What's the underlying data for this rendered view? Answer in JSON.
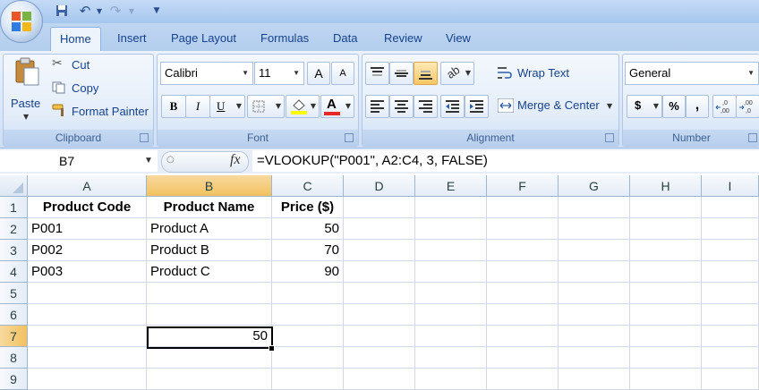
{
  "tabs": [
    "Home",
    "Insert",
    "Page Layout",
    "Formulas",
    "Data",
    "Review",
    "View"
  ],
  "clipboard": {
    "paste": "Paste",
    "cut": "Cut",
    "copy": "Copy",
    "format_painter": "Format Painter",
    "group": "Clipboard"
  },
  "font": {
    "name": "Calibri",
    "size": "11",
    "group": "Font",
    "bold": "B",
    "italic": "I",
    "underline": "U",
    "grow": "A",
    "shrink": "A"
  },
  "alignment": {
    "wrap": "Wrap Text",
    "merge": "Merge & Center",
    "group": "Alignment"
  },
  "number": {
    "format": "General",
    "group": "Number",
    "currency": "$",
    "percent": "%",
    "comma": ","
  },
  "formula_bar": {
    "name_box": "B7",
    "formula": "=VLOOKUP(\"P001\", A2:C4, 3, FALSE)",
    "fx": "fx"
  },
  "columns": [
    "A",
    "B",
    "C",
    "D",
    "E",
    "F",
    "G",
    "H",
    "I"
  ],
  "rows": [
    "1",
    "2",
    "3",
    "4",
    "5",
    "6",
    "7",
    "8",
    "9"
  ],
  "cells": {
    "A1": "Product Code",
    "B1": "Product Name",
    "C1": "Price ($)",
    "A2": "P001",
    "B2": "Product A",
    "C2": "50",
    "A3": "P002",
    "B3": "Product B",
    "C3": "70",
    "A4": "P003",
    "B4": "Product C",
    "C4": "90",
    "B7": "50"
  },
  "colors": {
    "accent": "#15428b",
    "selected_header": "#f1c15f",
    "font_color": "#e5282a",
    "highlight": "#ffff00"
  }
}
